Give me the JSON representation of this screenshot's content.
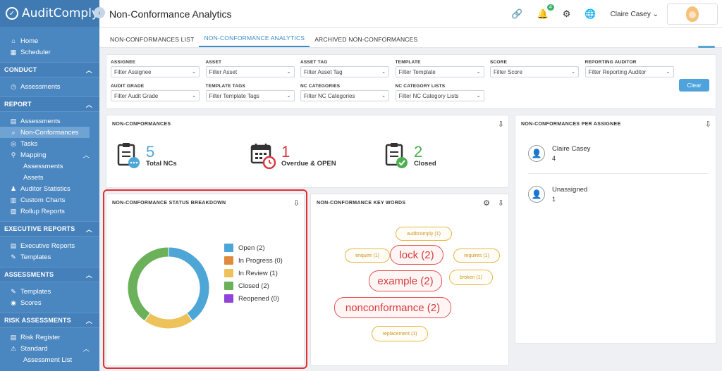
{
  "app": {
    "name": "AuditComply"
  },
  "sidebar": {
    "top_items": [
      {
        "label": "Home",
        "icon": "home-icon"
      },
      {
        "label": "Scheduler",
        "icon": "calendar-icon"
      }
    ],
    "sections": [
      {
        "title": "CONDUCT",
        "items": [
          {
            "label": "Assessments",
            "icon": "clock-icon",
            "sub": false
          }
        ]
      },
      {
        "title": "REPORT",
        "items": [
          {
            "label": "Assessments",
            "icon": "table-icon",
            "sub": false
          },
          {
            "label": "Non-Conformances",
            "icon": "search-icon",
            "sub": false,
            "active": true
          },
          {
            "label": "Tasks",
            "icon": "tasks-icon",
            "sub": false
          },
          {
            "label": "Mapping",
            "icon": "map-pin-icon",
            "sub": false,
            "chevron": "^"
          },
          {
            "label": "Assessments",
            "sub": true
          },
          {
            "label": "Assets",
            "sub": true
          },
          {
            "label": "Auditor Statistics",
            "icon": "user-stats-icon",
            "sub": false
          },
          {
            "label": "Custom Charts",
            "icon": "chart-icon",
            "sub": false
          },
          {
            "label": "Rollup Reports",
            "icon": "report-icon",
            "sub": false
          }
        ]
      },
      {
        "title": "EXECUTIVE REPORTS",
        "items": [
          {
            "label": "Executive Reports",
            "icon": "table-icon",
            "sub": false
          },
          {
            "label": "Templates",
            "icon": "edit-icon",
            "sub": false
          }
        ]
      },
      {
        "title": "ASSESSMENTS",
        "items": [
          {
            "label": "Templates",
            "icon": "edit-icon",
            "sub": false
          },
          {
            "label": "Scores",
            "icon": "target-icon",
            "sub": false
          }
        ]
      },
      {
        "title": "RISK ASSESSMENTS",
        "items": [
          {
            "label": "Risk Register",
            "icon": "table-icon",
            "sub": false
          },
          {
            "label": "Standard",
            "icon": "warning-icon",
            "sub": false,
            "chevron": "^"
          },
          {
            "label": "Assessment List",
            "sub": true
          }
        ]
      }
    ]
  },
  "header": {
    "title": "Non-Conformance Analytics",
    "notification_count": "4",
    "user_name": "Claire Casey"
  },
  "tabs": [
    {
      "label": "NON-CONFORMANCES LIST",
      "active": false
    },
    {
      "label": "NON-CONFORMANCE ANALYTICS",
      "active": true
    },
    {
      "label": "ARCHIVED NON-CONFORMANCES",
      "active": false
    }
  ],
  "filters": [
    {
      "label": "ASSIGNEE",
      "placeholder": "Filter Assignee"
    },
    {
      "label": "ASSET",
      "placeholder": "Filter Asset"
    },
    {
      "label": "ASSET TAG",
      "placeholder": "Filter Asset Tag"
    },
    {
      "label": "TEMPLATE",
      "placeholder": "Filter Template"
    },
    {
      "label": "SCORE",
      "placeholder": "Filter Score"
    },
    {
      "label": "REPORTING AUDITOR",
      "placeholder": "Filter Reporting Auditor"
    },
    {
      "label": "AUDIT GRADE",
      "placeholder": "Filter Audit Grade"
    },
    {
      "label": "TEMPLATE TAGS",
      "placeholder": "Filter Template Tags"
    },
    {
      "label": "NC CATEGORIES",
      "placeholder": "Filter NC Categories"
    },
    {
      "label": "NC CATEGORY LISTS",
      "placeholder": "Filter NC Category Lists"
    }
  ],
  "clear_label": "Clear",
  "nc_card": {
    "title": "NON-CONFORMANCES",
    "stats": [
      {
        "value": "5",
        "label": "Total NCs",
        "color": "#4ea6d6"
      },
      {
        "value": "1",
        "label": "Overdue & OPEN",
        "color": "#d9393e"
      },
      {
        "value": "2",
        "label": "Closed",
        "color": "#4caf50"
      }
    ]
  },
  "assignee_card": {
    "title": "NON-CONFORMANCES PER ASSIGNEE",
    "rows": [
      {
        "name": "Claire Casey",
        "count": "4"
      },
      {
        "name": "Unassigned",
        "count": "1"
      }
    ]
  },
  "status_card": {
    "title": "NON-CONFORMANCE STATUS BREAKDOWN",
    "legend": [
      {
        "label": "Open (2)",
        "color": "#4ea6d6"
      },
      {
        "label": "In Progress (0)",
        "color": "#e08a3c"
      },
      {
        "label": "In Review (1)",
        "color": "#eec25a"
      },
      {
        "label": "Closed (2)",
        "color": "#6ab15a"
      },
      {
        "label": "Reopened (0)",
        "color": "#8e44d8"
      }
    ]
  },
  "chart_data": {
    "type": "pie",
    "categories": [
      "Open",
      "In Progress",
      "In Review",
      "Closed",
      "Reopened"
    ],
    "values": [
      2,
      0,
      1,
      2,
      0
    ],
    "colors": [
      "#4ea6d6",
      "#e08a3c",
      "#eec25a",
      "#6ab15a",
      "#8e44d8"
    ],
    "title": "NON-CONFORMANCE STATUS BREAKDOWN",
    "donut": true,
    "legend_placement": "right"
  },
  "keywords_card": {
    "title": "NON-CONFORMANCE KEY WORDS",
    "words": [
      {
        "text": "auditcomply (1)",
        "weight": "small"
      },
      {
        "text": "enquire (1)",
        "weight": "small"
      },
      {
        "text": "lock (2)",
        "weight": "large"
      },
      {
        "text": "requires (1)",
        "weight": "small"
      },
      {
        "text": "example (2)",
        "weight": "large"
      },
      {
        "text": "broken (1)",
        "weight": "small"
      },
      {
        "text": "nonconformance (2)",
        "weight": "large"
      },
      {
        "text": "replacement (1)",
        "weight": "small"
      }
    ]
  }
}
